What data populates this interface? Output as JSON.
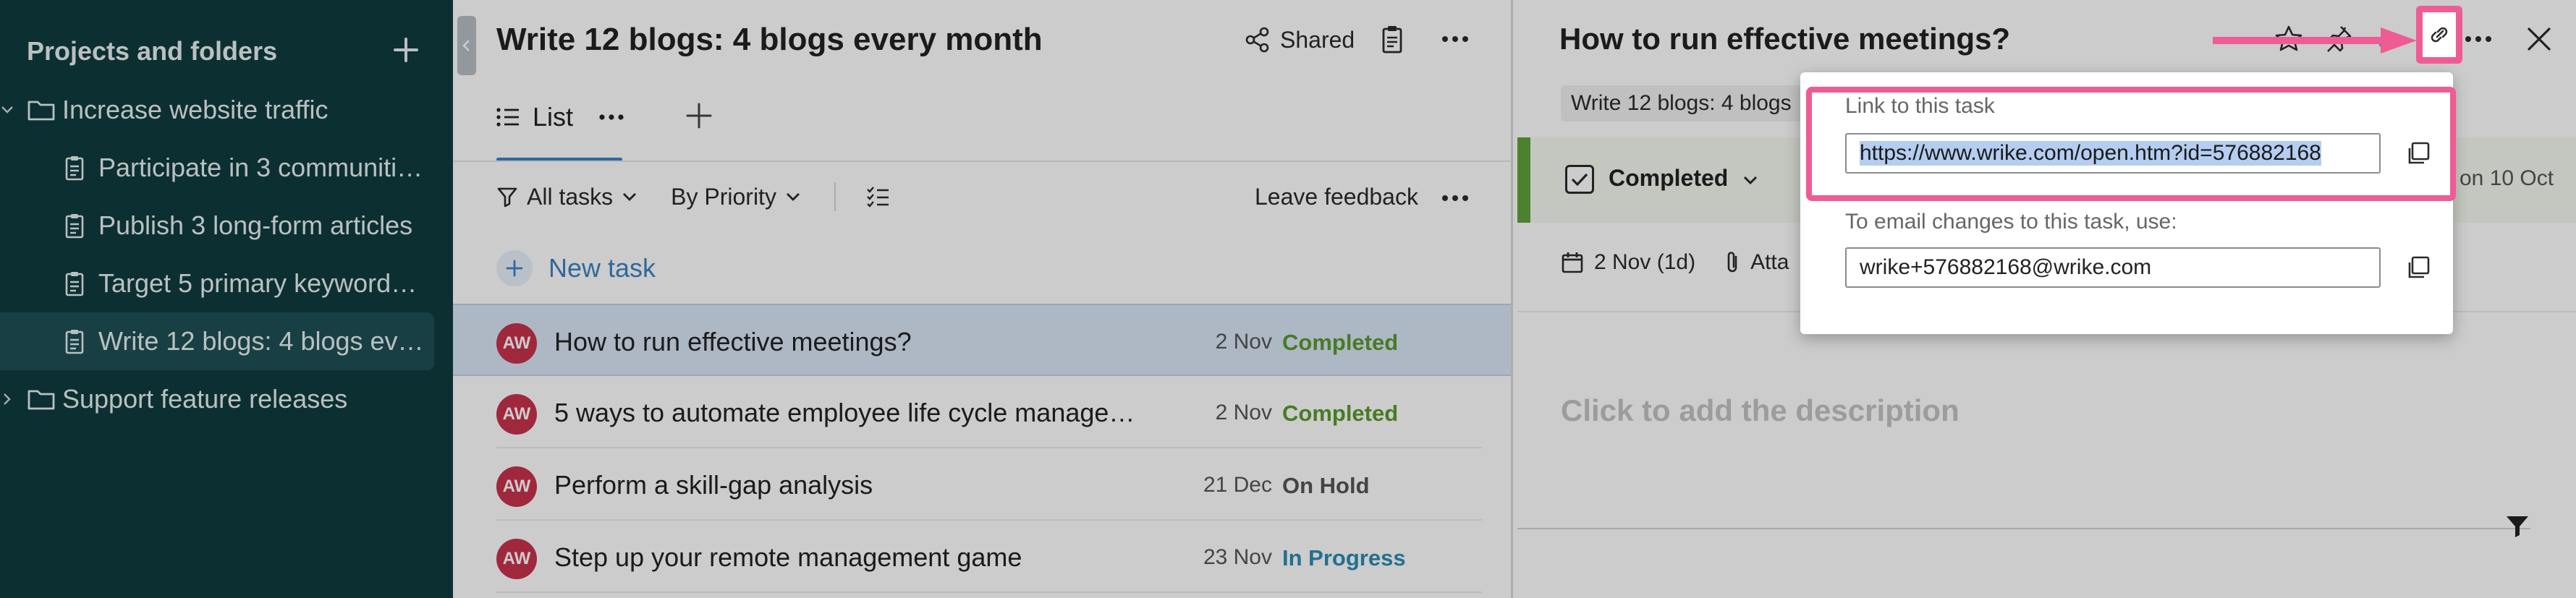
{
  "sidebar": {
    "title": "Projects and folders",
    "items": [
      {
        "label": "Increase website traffic",
        "kind": "folder"
      },
      {
        "label": "Participate in 3 communiti…",
        "kind": "task"
      },
      {
        "label": "Publish 3 long-form articles",
        "kind": "task"
      },
      {
        "label": "Target 5 primary keyword…",
        "kind": "task"
      },
      {
        "label": "Write 12 blogs: 4 blogs ev…",
        "kind": "task"
      },
      {
        "label": "Support feature releases",
        "kind": "folder"
      }
    ]
  },
  "middle": {
    "title": "Write 12 blogs: 4 blogs every month",
    "shared_label": "Shared",
    "view_tab": "List",
    "filters": {
      "all_tasks": "All tasks",
      "by_priority": "By Priority"
    },
    "leave_feedback": "Leave feedback",
    "new_task": "New task",
    "tasks": [
      {
        "avatar": "AW",
        "title": "How to run effective meetings?",
        "date": "2 Nov",
        "status": "Completed",
        "status_color": "#5a9a2e"
      },
      {
        "avatar": "AW",
        "title": "5 ways to automate employee life cycle managem…",
        "date": "2 Nov",
        "status": "Completed",
        "status_color": "#5a9a2e"
      },
      {
        "avatar": "AW",
        "title": "Perform a skill-gap analysis",
        "date": "21 Dec",
        "status": "On Hold",
        "status_color": "#555555"
      },
      {
        "avatar": "AW",
        "title": "Step up your remote management game",
        "date": "23 Nov",
        "status": "In Progress",
        "status_color": "#2b8cb3"
      }
    ]
  },
  "right": {
    "title": "How to run effective meetings?",
    "breadcrumb": "Write 12 blogs: 4 blogs",
    "status": "Completed",
    "created": "on 10 Oct",
    "date": "2 Nov (1d)",
    "attach": "Atta",
    "description_placeholder": "Click to add the description"
  },
  "popup": {
    "link_label": "Link to this task",
    "link_url": "https://www.wrike.com/open.htm?id=576882168",
    "email_label": "To email changes to this task, use:",
    "email": "wrike+576882168@wrike.com"
  },
  "colors": {
    "sidebar_bg": "#0f3b3f",
    "accent_blue": "#3b82c4",
    "highlight_pink": "#ef5c95",
    "avatar_red": "#c9334d"
  }
}
